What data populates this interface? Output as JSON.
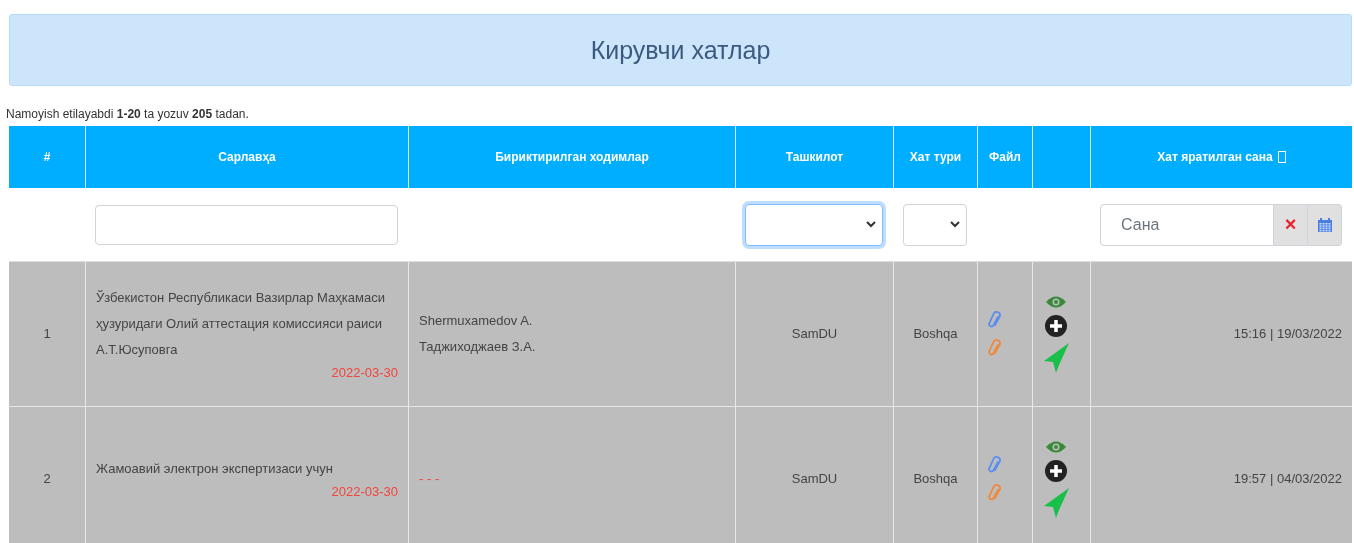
{
  "page_title": "Кирувчи хатлар",
  "summary": "Namoyish etilayabdi **1-20** ta yozuv **205** tadan.",
  "table": {
    "columns": [
      {
        "label": "#"
      },
      {
        "label": "Сарлавҳа"
      },
      {
        "label": "Бириктирилган ходимлар"
      },
      {
        "label": "Ташкилот"
      },
      {
        "label": "Хат тури"
      },
      {
        "label": "Файл"
      },
      {
        "label": "Хат яратилган сана",
        "sortable": true
      }
    ],
    "filters": {
      "title": {
        "kind": "text"
      },
      "organization": {
        "focused": true
      },
      "type": {
        "focused": false
      },
      "date": {
        "placeholder": "Сана",
        "clear": "×"
      }
    },
    "rows": [
      {
        "number": "1",
        "title": "Ўзбекистон Республикаси Вазирлар Маҳкамаси ҳузуридаги Олий аттестация комиссияси раиси А.Т.Юсуповга",
        "due": "2022-03-30",
        "staff": [
          "Shermuxamedov A.",
          "Таджиходжаев З.А."
        ],
        "staff_empty": false,
        "organization": "SamDU",
        "type": "Boshqa",
        "attachments": [
          {
            "color": "#5b8def"
          },
          {
            "color": "#f0883a"
          }
        ],
        "created": "15:16 | 19/03/2022"
      },
      {
        "number": "2",
        "title": "Жамоавий электрон экспертизаси учун",
        "due": "2022-03-30",
        "staff": [
          "- - -"
        ],
        "staff_empty": true,
        "organization": "SamDU",
        "type": "Boshqa",
        "attachments": [
          {
            "color": "#5b8def"
          },
          {
            "color": "#f0883a"
          }
        ],
        "created": "19:57 | 04/03/2022"
      }
    ]
  }
}
